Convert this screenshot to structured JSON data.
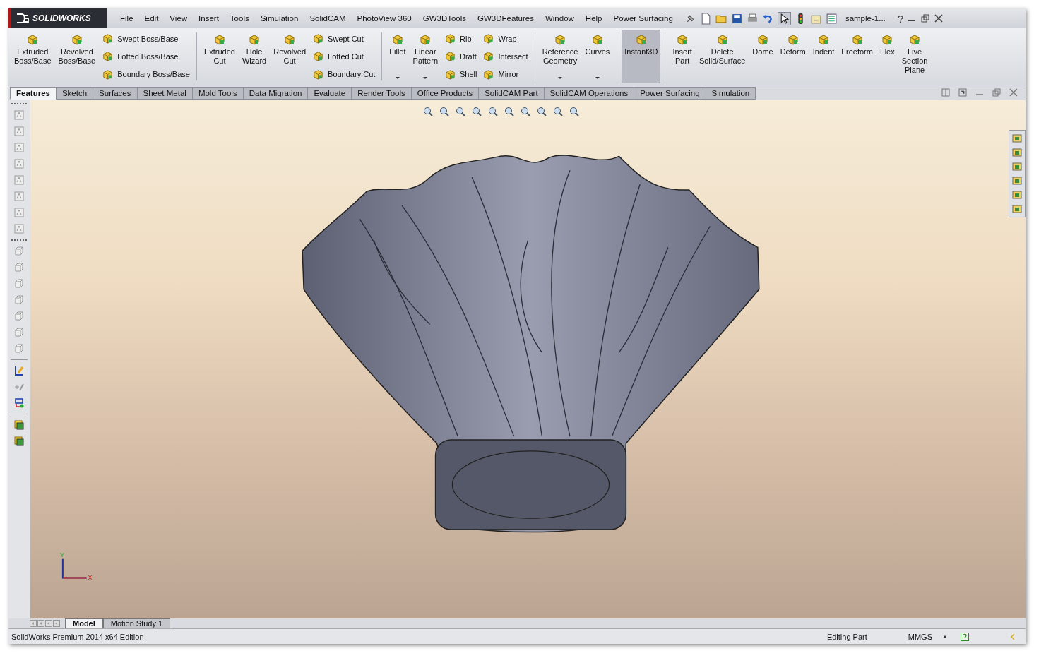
{
  "app": {
    "logo": "SOLIDWORKS",
    "menu": [
      "File",
      "Edit",
      "View",
      "Insert",
      "Tools",
      "Simulation",
      "SolidCAM",
      "PhotoView 360",
      "GW3DTools",
      "GW3DFeatures",
      "Window",
      "Help",
      "Power Surfacing"
    ],
    "document_title": "sample-1...",
    "help": "?"
  },
  "ribbon": {
    "groups": [
      {
        "items": [
          {
            "kind": "large",
            "label": "Extruded\nBoss/Base",
            "dropdown": false,
            "selected": false
          },
          {
            "kind": "large",
            "label": "Revolved\nBoss/Base",
            "dropdown": false,
            "selected": false
          },
          {
            "kind": "stack",
            "items": [
              "Swept Boss/Base",
              "Lofted Boss/Base",
              "Boundary Boss/Base"
            ]
          }
        ]
      },
      {
        "items": [
          {
            "kind": "large",
            "label": "Extruded\nCut",
            "dropdown": false,
            "selected": false
          },
          {
            "kind": "large",
            "label": "Hole\nWizard",
            "dropdown": false,
            "selected": false
          },
          {
            "kind": "large",
            "label": "Revolved\nCut",
            "dropdown": false,
            "selected": false
          },
          {
            "kind": "stack",
            "items": [
              "Swept Cut",
              "Lofted Cut",
              "Boundary Cut"
            ]
          }
        ]
      },
      {
        "items": [
          {
            "kind": "large",
            "label": "Fillet",
            "dropdown": true,
            "selected": false
          },
          {
            "kind": "large",
            "label": "Linear\nPattern",
            "dropdown": true,
            "selected": false
          },
          {
            "kind": "stack",
            "items": [
              "Rib",
              "Draft",
              "Shell"
            ]
          },
          {
            "kind": "stack",
            "items": [
              "Wrap",
              "Intersect",
              "Mirror"
            ]
          }
        ]
      },
      {
        "items": [
          {
            "kind": "large",
            "label": "Reference\nGeometry",
            "dropdown": true,
            "selected": false
          },
          {
            "kind": "large",
            "label": "Curves",
            "dropdown": true,
            "selected": false
          }
        ]
      },
      {
        "items": [
          {
            "kind": "large",
            "label": "Instant3D",
            "dropdown": false,
            "selected": true
          }
        ]
      },
      {
        "items": [
          {
            "kind": "large",
            "label": "Insert\nPart",
            "dropdown": false,
            "selected": false
          },
          {
            "kind": "large",
            "label": "Delete\nSolid/Surface",
            "dropdown": false,
            "selected": false
          },
          {
            "kind": "large",
            "label": "Dome",
            "dropdown": false,
            "selected": false
          },
          {
            "kind": "large",
            "label": "Deform",
            "dropdown": false,
            "selected": false
          },
          {
            "kind": "large",
            "label": "Indent",
            "dropdown": false,
            "selected": false
          },
          {
            "kind": "large",
            "label": "Freeform",
            "dropdown": false,
            "selected": false
          },
          {
            "kind": "large",
            "label": "Flex",
            "dropdown": false,
            "selected": false
          },
          {
            "kind": "large",
            "label": "Live\nSection\nPlane",
            "dropdown": false,
            "selected": false
          }
        ]
      }
    ]
  },
  "tabs": [
    {
      "label": "Features",
      "selected": true
    },
    {
      "label": "Sketch",
      "selected": false
    },
    {
      "label": "Surfaces",
      "selected": false
    },
    {
      "label": "Sheet Metal",
      "selected": false
    },
    {
      "label": "Mold Tools",
      "selected": false
    },
    {
      "label": "Data Migration",
      "selected": false
    },
    {
      "label": "Evaluate",
      "selected": false
    },
    {
      "label": "Render Tools",
      "selected": false
    },
    {
      "label": "Office Products",
      "selected": false
    },
    {
      "label": "SolidCAM Part",
      "selected": false
    },
    {
      "label": "SolidCAM Operations",
      "selected": false
    },
    {
      "label": "Power Surfacing",
      "selected": false
    },
    {
      "label": "Simulation",
      "selected": false
    }
  ],
  "triad": {
    "x_label": "X",
    "y_label": "Y"
  },
  "model_tabs": [
    {
      "label": "Model",
      "selected": true
    },
    {
      "label": "Motion Study 1",
      "selected": false
    }
  ],
  "status_bar": {
    "edition": "SolidWorks Premium 2014 x64 Edition",
    "mode": "Editing Part",
    "units": "MMGS"
  }
}
